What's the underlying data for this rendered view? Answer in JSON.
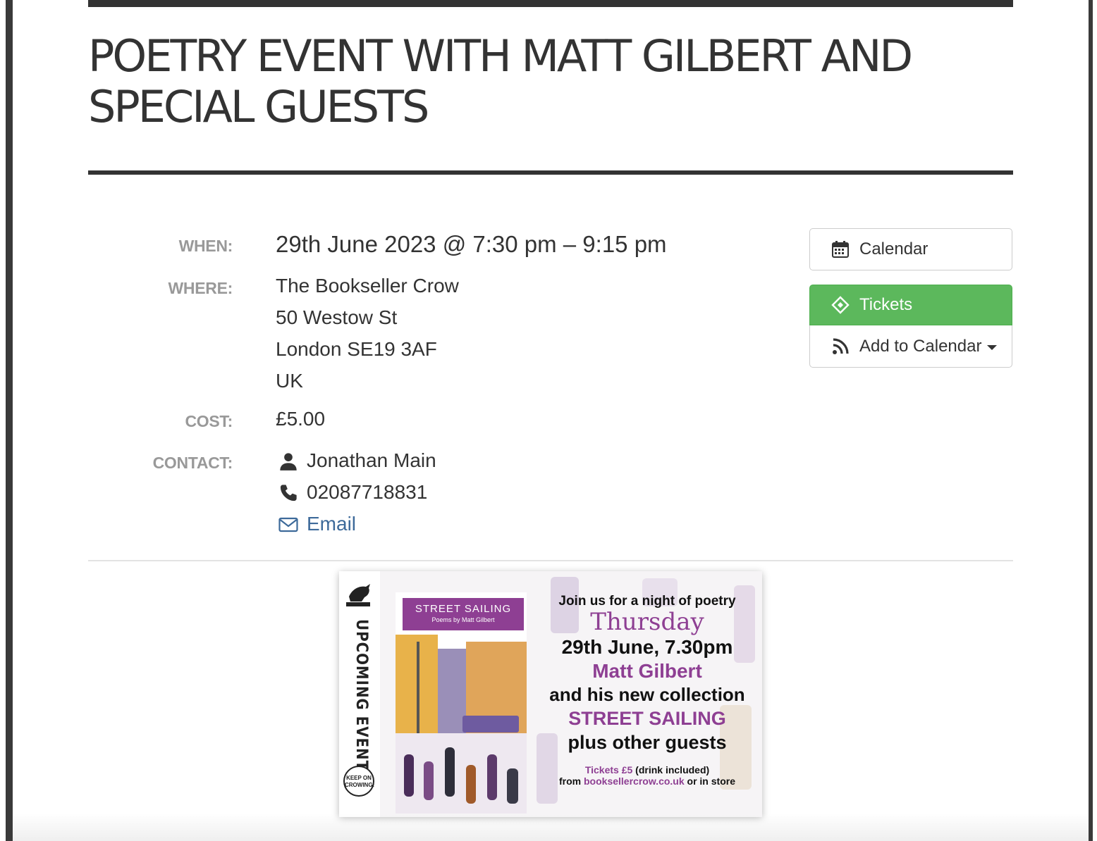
{
  "event": {
    "title": "POETRY EVENT WITH MATT GILBERT AND SPECIAL GUESTS"
  },
  "details": {
    "when_label": "WHEN:",
    "when_value": "29th June 2023 @ 7:30 pm – 9:15 pm",
    "where_label": "WHERE:",
    "where_lines": [
      "The Bookseller Crow",
      "50 Westow St",
      "London SE19 3AF",
      "UK"
    ],
    "cost_label": "COST:",
    "cost_value": "£5.00",
    "contact_label": "CONTACT:",
    "contact_name": "Jonathan Main",
    "contact_phone": "02087718831",
    "contact_email_label": "Email"
  },
  "actions": {
    "calendar_label": "Calendar",
    "tickets_label": "Tickets",
    "add_to_calendar_label": "Add to Calendar"
  },
  "icons": {
    "calendar": "calendar-icon",
    "tickets": "ticket-icon",
    "add_to_calendar": "rss-icon",
    "contact_name": "user-icon",
    "contact_phone": "phone-icon",
    "contact_email": "envelope-icon"
  },
  "colors": {
    "tickets_bg": "#5cb85c",
    "link": "#3d6a9a",
    "label": "#999999",
    "poster_accent": "#8e3f93"
  },
  "poster": {
    "side_text": "UPCOMING EVENTS",
    "badge_text": "KEEP ON CROWING!",
    "book_title": "STREET SAILING",
    "book_subtitle": "Poems by Matt Gilbert",
    "line1": "Join us for a night of poetry",
    "line2": "Thursday",
    "line3": "29th June, 7.30pm",
    "line4": "Matt Gilbert",
    "line5": "and his new collection",
    "line6": "STREET SAILING",
    "line7": "plus other guests",
    "line8a": "Tickets £5",
    "line8b": "(drink included)",
    "line9a": "from",
    "line9b": "booksellercrow.co.uk",
    "line9c": "or in store"
  }
}
